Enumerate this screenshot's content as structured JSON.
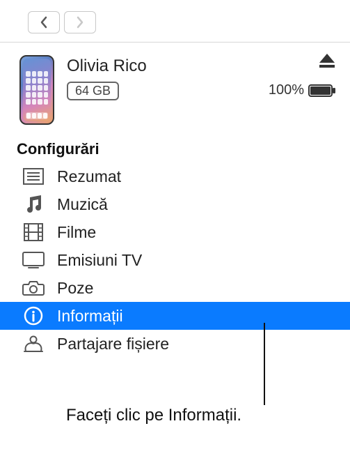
{
  "device": {
    "name": "Olivia Rico",
    "storage": "64 GB",
    "battery_pct": "100%"
  },
  "sidebar": {
    "section_title": "Configurări",
    "items": [
      {
        "label": "Rezumat"
      },
      {
        "label": "Muzică"
      },
      {
        "label": "Filme"
      },
      {
        "label": "Emisiuni TV"
      },
      {
        "label": "Poze"
      },
      {
        "label": "Informații"
      },
      {
        "label": "Partajare fișiere"
      }
    ],
    "selected_index": 5
  },
  "callout": "Faceți clic pe Informații."
}
